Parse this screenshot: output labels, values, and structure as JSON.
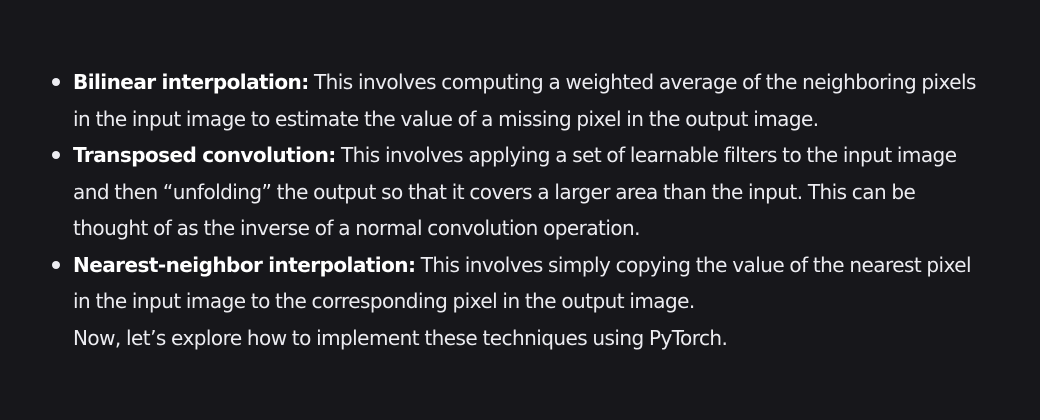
{
  "content": {
    "items": [
      {
        "term": "Bilinear interpolation:",
        "text": " This involves computing a weighted average of the neighboring pixels in the input image to estimate the value of a missing pixel in the output image."
      },
      {
        "term": "Transposed convolution:",
        "text": " This involves applying a set of learnable filters to the input image and then “unfolding” the output so that it covers a larger area than the input. This can be thought of as the inverse of a normal convolution operation."
      },
      {
        "term": "Nearest-neighbor interpolation:",
        "text": " This involves simply copying the value of the nearest pixel in the input image to the corresponding pixel in the output image."
      }
    ],
    "trailing_text": "Now, let’s explore how to implement these techniques using PyTorch."
  }
}
